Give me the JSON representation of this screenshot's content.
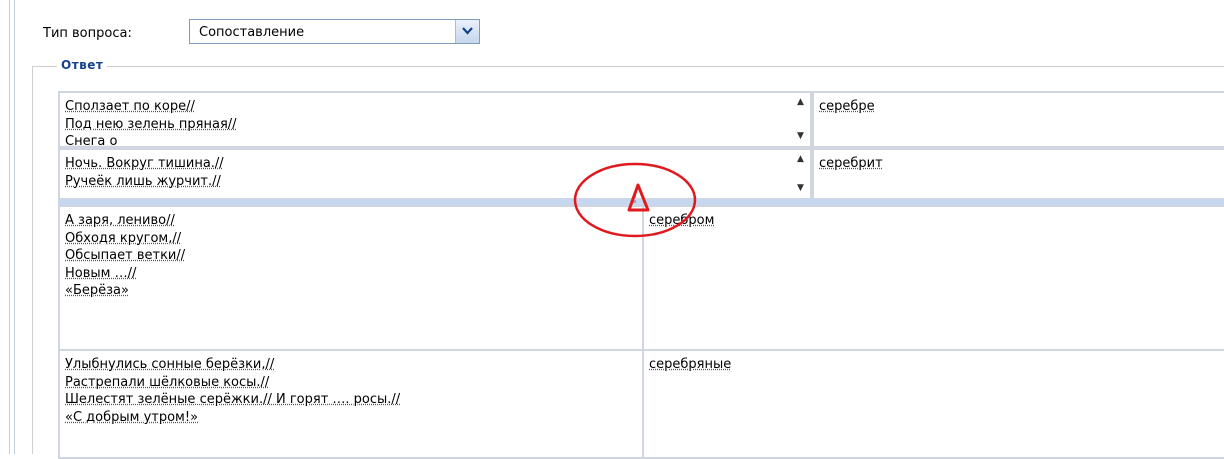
{
  "question_type": {
    "label": "Тип вопроса:",
    "selected": "Сопоставление"
  },
  "answer_section": {
    "legend": "Ответ"
  },
  "rows": [
    {
      "left_lines": [
        "Сползает по коре//",
        "Под нею зелень пряная//",
        "Снега о"
      ],
      "right": "серебре",
      "collapsed": true
    },
    {
      "left_lines": [
        "Ночь. Вокруг тишина.//",
        "Ручеёк лишь журчит.//",
        "…"
      ],
      "right": "серебрит",
      "collapsed": true
    },
    {
      "left_lines": [
        "А заря, лениво//",
        "Обходя кругом,//",
        "Обсыпает ветки//",
        "Новым …//",
        "«Берёза»"
      ],
      "right": "серебром",
      "collapsed": false
    },
    {
      "left_lines": [
        "Улыбнулись сонные берёзки,//",
        "Растрепали шёлковые косы.//",
        "Шелестят зелёные серёжки.// И горят …. росы.//",
        "«С добрым утром!»"
      ],
      "right": "серебряные",
      "collapsed": false
    }
  ],
  "colors": {
    "legend": "#15428b",
    "annotation": "#e0191f",
    "drop_indicator": "#c6d8f0",
    "spell_underline": "#d42020"
  },
  "icons": {
    "combo_arrow": "chevron-down-icon",
    "drop_warning": "triangle-warning-icon"
  }
}
